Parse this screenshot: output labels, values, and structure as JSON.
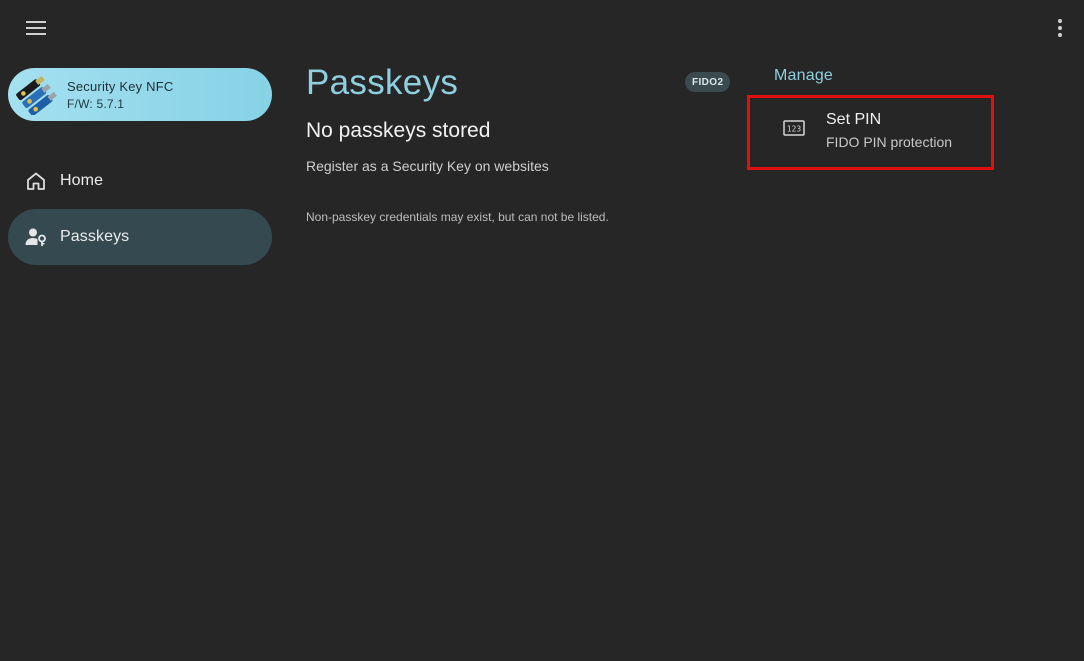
{
  "device": {
    "name": "Security Key NFC",
    "firmware": "F/W: 5.7.1"
  },
  "nav": {
    "items": [
      {
        "label": "Home",
        "icon": "home-icon",
        "selected": false
      },
      {
        "label": "Passkeys",
        "icon": "person-key-icon",
        "selected": true
      }
    ]
  },
  "main": {
    "title": "Passkeys",
    "badge": "FIDO2",
    "empty_title": "No passkeys stored",
    "empty_subtitle": "Register as a Security Key on websites",
    "note": "Non-passkey credentials may exist, but can not be listed."
  },
  "manage": {
    "heading": "Manage",
    "items": [
      {
        "title": "Set PIN",
        "subtitle": "FIDO PIN protection",
        "icon": "pin-123-icon",
        "highlighted": true
      }
    ]
  },
  "colors": {
    "background": "#262626",
    "accent": "#8fcfe0",
    "selected_nav": "#344a50",
    "highlight": "#e01010"
  }
}
